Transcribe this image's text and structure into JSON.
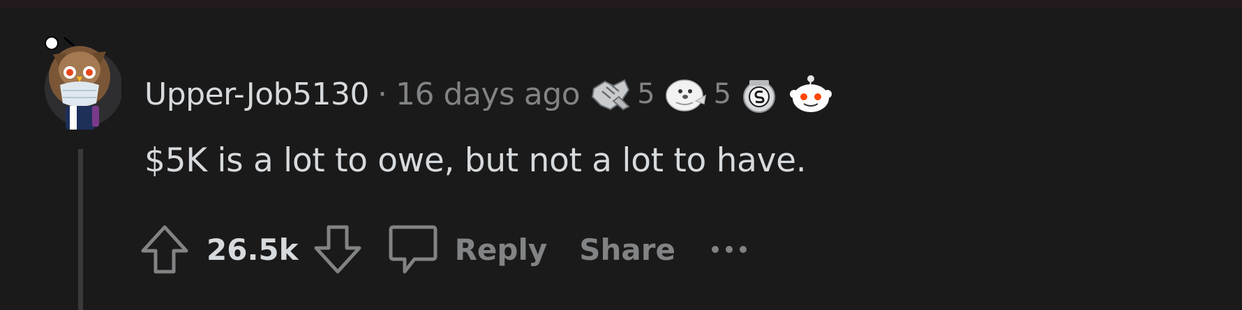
{
  "comment": {
    "username": "Upper-Job5130",
    "separator": "·",
    "timestamp": "16 days ago",
    "awards": [
      {
        "icon": "handshake-award-icon",
        "count": "5"
      },
      {
        "icon": "wholesome-seal-award-icon",
        "count": "5"
      },
      {
        "icon": "silver-award-icon",
        "count": ""
      },
      {
        "icon": "snoo-award-icon",
        "count": ""
      }
    ],
    "body": "$5K is a lot to owe, but not a lot to have.",
    "score": "26.5k",
    "actions": {
      "reply_label": "Reply",
      "share_label": "Share"
    }
  },
  "colors": {
    "background": "#1a1a1b",
    "text_primary": "#d7dadc",
    "text_secondary": "#818384",
    "thread_line": "#3a3a3c"
  }
}
